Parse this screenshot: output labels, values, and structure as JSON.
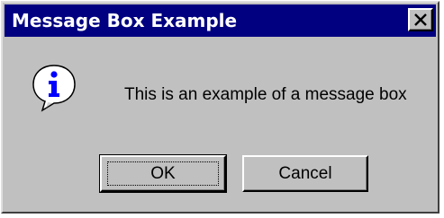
{
  "window": {
    "title": "Message Box Example",
    "close_icon": "close-x-icon"
  },
  "content": {
    "icon": "information-icon",
    "message": "This is an example of a message box"
  },
  "buttons": {
    "ok_label": "OK",
    "cancel_label": "Cancel",
    "default": "OK"
  },
  "colors": {
    "titlebar": "#000080",
    "title_text": "#ffffff",
    "face": "#c0c0c0",
    "info_blue": "#0000ff"
  }
}
